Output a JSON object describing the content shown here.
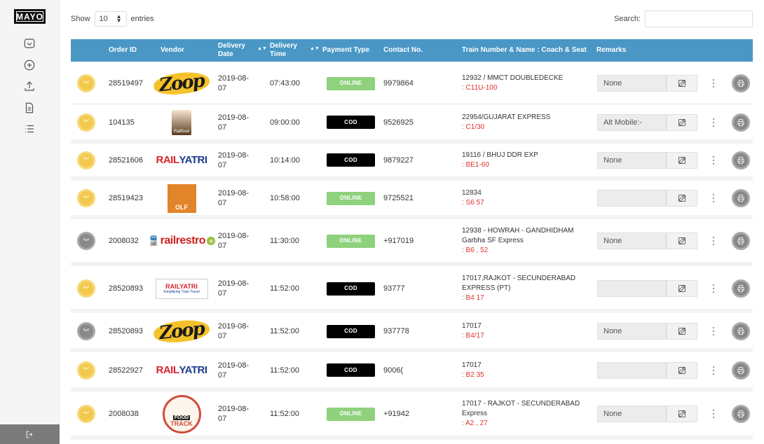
{
  "app": {
    "logo_text": "MAYO"
  },
  "sidebar": {
    "icons": [
      "inbox-icon",
      "add-circle-icon",
      "upload-icon",
      "document-icon",
      "list-icon"
    ],
    "logout_icon": "logout-icon"
  },
  "controls": {
    "show_label": "Show",
    "entries_value": "10",
    "entries_label": "entries",
    "search_label": "Search:",
    "search_value": ""
  },
  "table": {
    "headers": {
      "order_id": "Order ID",
      "vendor": "Vendor",
      "delivery_date": "Delivery Date",
      "delivery_time": "Delivery Time",
      "payment_type": "Payment Type",
      "contact": "Contact No.",
      "train": "Train Number & Name : Coach & Seat",
      "remarks": "Remarks"
    },
    "rows": [
      {
        "status": "yellow",
        "order_id": "28519497",
        "vendor": "zoop",
        "date_line1": "2019-08-",
        "date_line2": "07",
        "time": "07:43:00",
        "payment": "ONLINE",
        "contact": "9979864",
        "train_line1": "12932 / MMCT DOUBLEDECKE",
        "train_line2": "",
        "seat": ": C11U-100",
        "remark": "None"
      },
      {
        "status": "yellow",
        "order_id": "104135",
        "vendor": "foodonrail",
        "date_line1": "2019-08-",
        "date_line2": "07",
        "time": "09:00:00",
        "payment": "COD",
        "contact": "9526925",
        "train_line1": "22954/GUJARAT EXPRESS",
        "train_line2": "",
        "seat": ": C1/30",
        "remark": "Alt Mobile:-"
      },
      {
        "status": "yellow",
        "order_id": "28521606",
        "vendor": "railyatri",
        "date_line1": "2019-08-",
        "date_line2": "07",
        "time": "10:14:00",
        "payment": "COD",
        "contact": "9879227",
        "train_line1": "19116 / BHUJ DDR EXP",
        "train_line2": "",
        "seat": ": BE1-60",
        "remark": "None"
      },
      {
        "status": "yellow",
        "order_id": "28519423",
        "vendor": "olf",
        "date_line1": "2019-08-",
        "date_line2": "07",
        "time": "10:58:00",
        "payment": "ONLINE",
        "contact": "9725521",
        "train_line1": "12834",
        "train_line2": "",
        "seat": ": S6 57",
        "remark": ""
      },
      {
        "status": "grey",
        "order_id": "2008032",
        "vendor": "railrestro",
        "date_line1": "2019-08-",
        "date_line2": "07",
        "time": "11:30:00",
        "payment": "ONLINE",
        "contact": "+917019(",
        "train_line1": "12938 - HOWRAH - GANDHIDHAM",
        "train_line2": "Garbha SF Express",
        "seat": ": B6 , 52",
        "remark": "None"
      },
      {
        "status": "yellow",
        "order_id": "28520893",
        "vendor": "railyatri-box",
        "date_line1": "2019-08-",
        "date_line2": "07",
        "time": "11:52:00",
        "payment": "COD",
        "contact": "93777",
        "train_line1": "17017,RAJKOT - SECUNDERABAD",
        "train_line2": "EXPRESS (PT)",
        "seat": ": B4 17",
        "remark": ""
      },
      {
        "status": "grey",
        "order_id": "28520893",
        "vendor": "zoop",
        "date_line1": "2019-08-",
        "date_line2": "07",
        "time": "11:52:00",
        "payment": "COD",
        "contact": "937778",
        "train_line1": "17017",
        "train_line2": "",
        "seat": ": B4/17",
        "remark": "None"
      },
      {
        "status": "yellow",
        "order_id": "28522927",
        "vendor": "railyatri",
        "date_line1": "2019-08-",
        "date_line2": "07",
        "time": "11:52:00",
        "payment": "COD",
        "contact": "9006(",
        "train_line1": "17017",
        "train_line2": "",
        "seat": ": B2 35",
        "remark": ""
      },
      {
        "status": "yellow",
        "order_id": "2008038",
        "vendor": "foodtrack",
        "date_line1": "2019-08-",
        "date_line2": "07",
        "time": "11:52:00",
        "payment": "ONLINE",
        "contact": "+91942",
        "train_line1": "17017 - RAJKOT - SECUNDERABAD",
        "train_line2": "Express",
        "seat": ": A2 , 27",
        "remark": "None"
      }
    ]
  },
  "vendor_logos": {
    "zoop": "Zoop",
    "railyatri_a": "RAIL",
    "railyatri_b": "YATRI",
    "olf": "OLF",
    "foodonrail": "Railfood",
    "railrestro": "railrestro",
    "railyatri_box": "RAILYATRI",
    "railyatri_box_sub": "Simplifying Train Travel",
    "foodtrack_a": "FOOD",
    "foodtrack_b": "TRACK"
  },
  "colors": {
    "header": "#4a97c6",
    "online": "#8fd17c",
    "cod": "#000000",
    "seat": "#e0312b",
    "pending": "#f2c94c"
  }
}
